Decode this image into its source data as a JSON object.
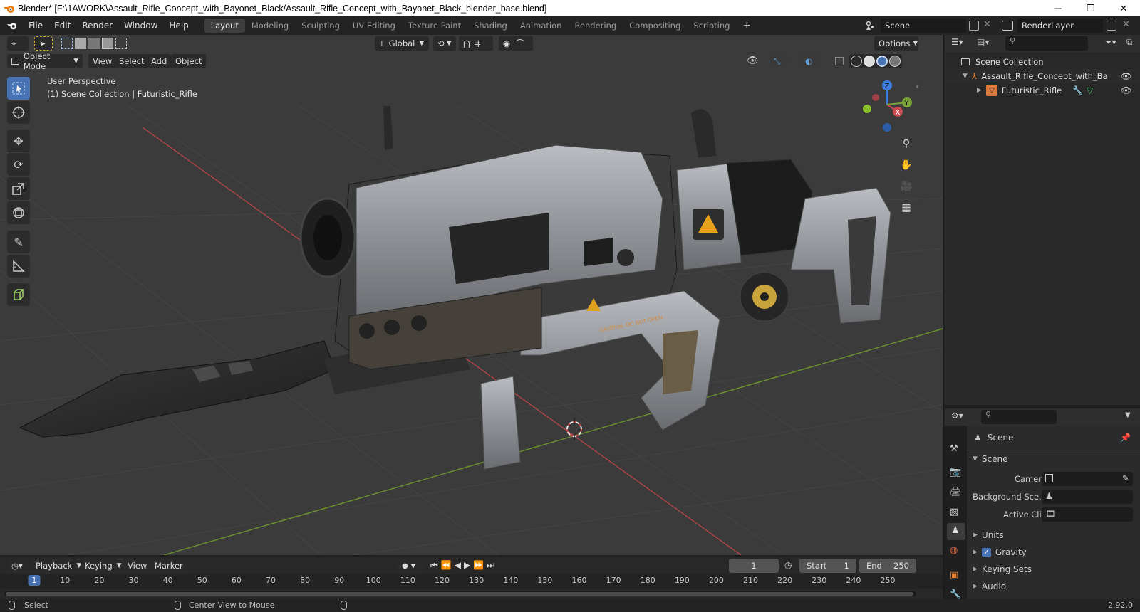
{
  "window": {
    "title": "Blender* [F:\\1AWORK\\Assault_Rifle_Concept_with_Bayonet_Black/Assault_Rifle_Concept_with_Bayonet_Black_blender_base.blend]",
    "minimize": "─",
    "maximize": "❐",
    "close": "✕"
  },
  "menu": [
    "File",
    "Edit",
    "Render",
    "Window",
    "Help"
  ],
  "workspaces": [
    "Layout",
    "Modeling",
    "Sculpting",
    "UV Editing",
    "Texture Paint",
    "Shading",
    "Animation",
    "Rendering",
    "Compositing",
    "Scripting"
  ],
  "workspace_add": "+",
  "scene_selector": {
    "value": "Scene"
  },
  "view_layer": {
    "value": "RenderLayer"
  },
  "viewport_header": {
    "mode": "Object Mode",
    "menus": [
      "View",
      "Select",
      "Add",
      "Object"
    ],
    "transform_orientation": "Global",
    "options": "Options"
  },
  "viewport_overlay": {
    "perspective": "User Perspective",
    "collection": "(1) Scene Collection | Futuristic_Rifle"
  },
  "gizmo": {
    "x": "X",
    "y": "Y",
    "z": "Z"
  },
  "rifle_decals": {
    "caution": "CAUTION. DO NOT OPEN."
  },
  "outliner": {
    "root": "Scene Collection",
    "items": [
      {
        "label": "Assault_Rifle_Concept_with_Bayo"
      },
      {
        "label": "Futuristic_Rifle"
      }
    ]
  },
  "properties": {
    "header": "Scene",
    "section": "Scene",
    "fields": [
      {
        "label": "Camera"
      },
      {
        "label": "Background Sce..."
      },
      {
        "label": "Active Clip"
      }
    ],
    "panels": [
      {
        "label": "Units",
        "checkbox": false
      },
      {
        "label": "Gravity",
        "checkbox": true
      },
      {
        "label": "Keying Sets",
        "checkbox": false
      },
      {
        "label": "Audio",
        "checkbox": false
      }
    ]
  },
  "timeline": {
    "menus": [
      "Playback",
      "Keying",
      "View",
      "Marker"
    ],
    "current_frame": "1",
    "start_label": "Start",
    "start_value": "1",
    "end_label": "End",
    "end_value": "250",
    "ticks": [
      "1",
      "10",
      "20",
      "30",
      "40",
      "50",
      "60",
      "70",
      "80",
      "90",
      "100",
      "110",
      "120",
      "130",
      "140",
      "150",
      "160",
      "170",
      "180",
      "190",
      "200",
      "210",
      "220",
      "230",
      "240",
      "250"
    ]
  },
  "status": {
    "select": "Select",
    "center": "Center View to Mouse",
    "version": "2.92.0"
  },
  "colors": {
    "accent": "#4772b3",
    "viewport_bg": "#3b3b3b",
    "panel_bg": "#282828",
    "x_axis": "#c94a50",
    "y_axis": "#7ba33a",
    "z_axis": "#3c7ee0"
  }
}
